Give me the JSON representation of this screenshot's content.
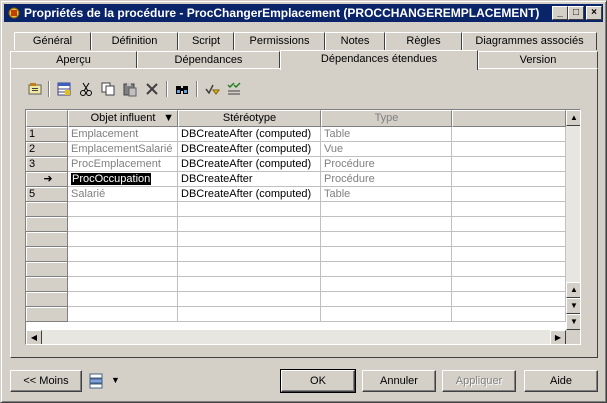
{
  "window": {
    "title": "Propriétés de la procédure - ProcChangerEmplacement (PROCCHANGEREMPLACEMENT)",
    "minimize": "_",
    "maximize": "□",
    "close": "×"
  },
  "tabs_row1": [
    "Général",
    "Définition",
    "Script",
    "Permissions",
    "Notes",
    "Règles",
    "Diagrammes associés"
  ],
  "tabs_row2": [
    "Aperçu",
    "Dépendances",
    "Dépendances étendues",
    "Version"
  ],
  "active_tab": "Dépendances étendues",
  "toolbar": {
    "icons": [
      "properties-icon",
      "add-rows-icon",
      "cut-icon",
      "copy-icon",
      "paste-icon",
      "delete-icon",
      "find-icon",
      "filter-icon",
      "customize-columns-icon"
    ]
  },
  "grid": {
    "columns": [
      "Objet influent",
      "Stéréotype",
      "Type"
    ],
    "rows": [
      {
        "num": "1",
        "objet": "Emplacement",
        "stereotype": "DBCreateAfter (computed)",
        "type": "Table"
      },
      {
        "num": "2",
        "objet": "EmplacementSalarié",
        "stereotype": "DBCreateAfter (computed)",
        "type": "Vue"
      },
      {
        "num": "3",
        "objet": "ProcEmplacement",
        "stereotype": "DBCreateAfter (computed)",
        "type": "Procédure"
      },
      {
        "num": "➜",
        "objet": "ProcOccupation",
        "stereotype": "DBCreateAfter",
        "type": "Procédure"
      },
      {
        "num": "5",
        "objet": "Salarié",
        "stereotype": "DBCreateAfter (computed)",
        "type": "Table"
      }
    ]
  },
  "buttons": {
    "less": "<< Moins",
    "ok": "OK",
    "cancel": "Annuler",
    "apply": "Appliquer",
    "help": "Aide"
  }
}
